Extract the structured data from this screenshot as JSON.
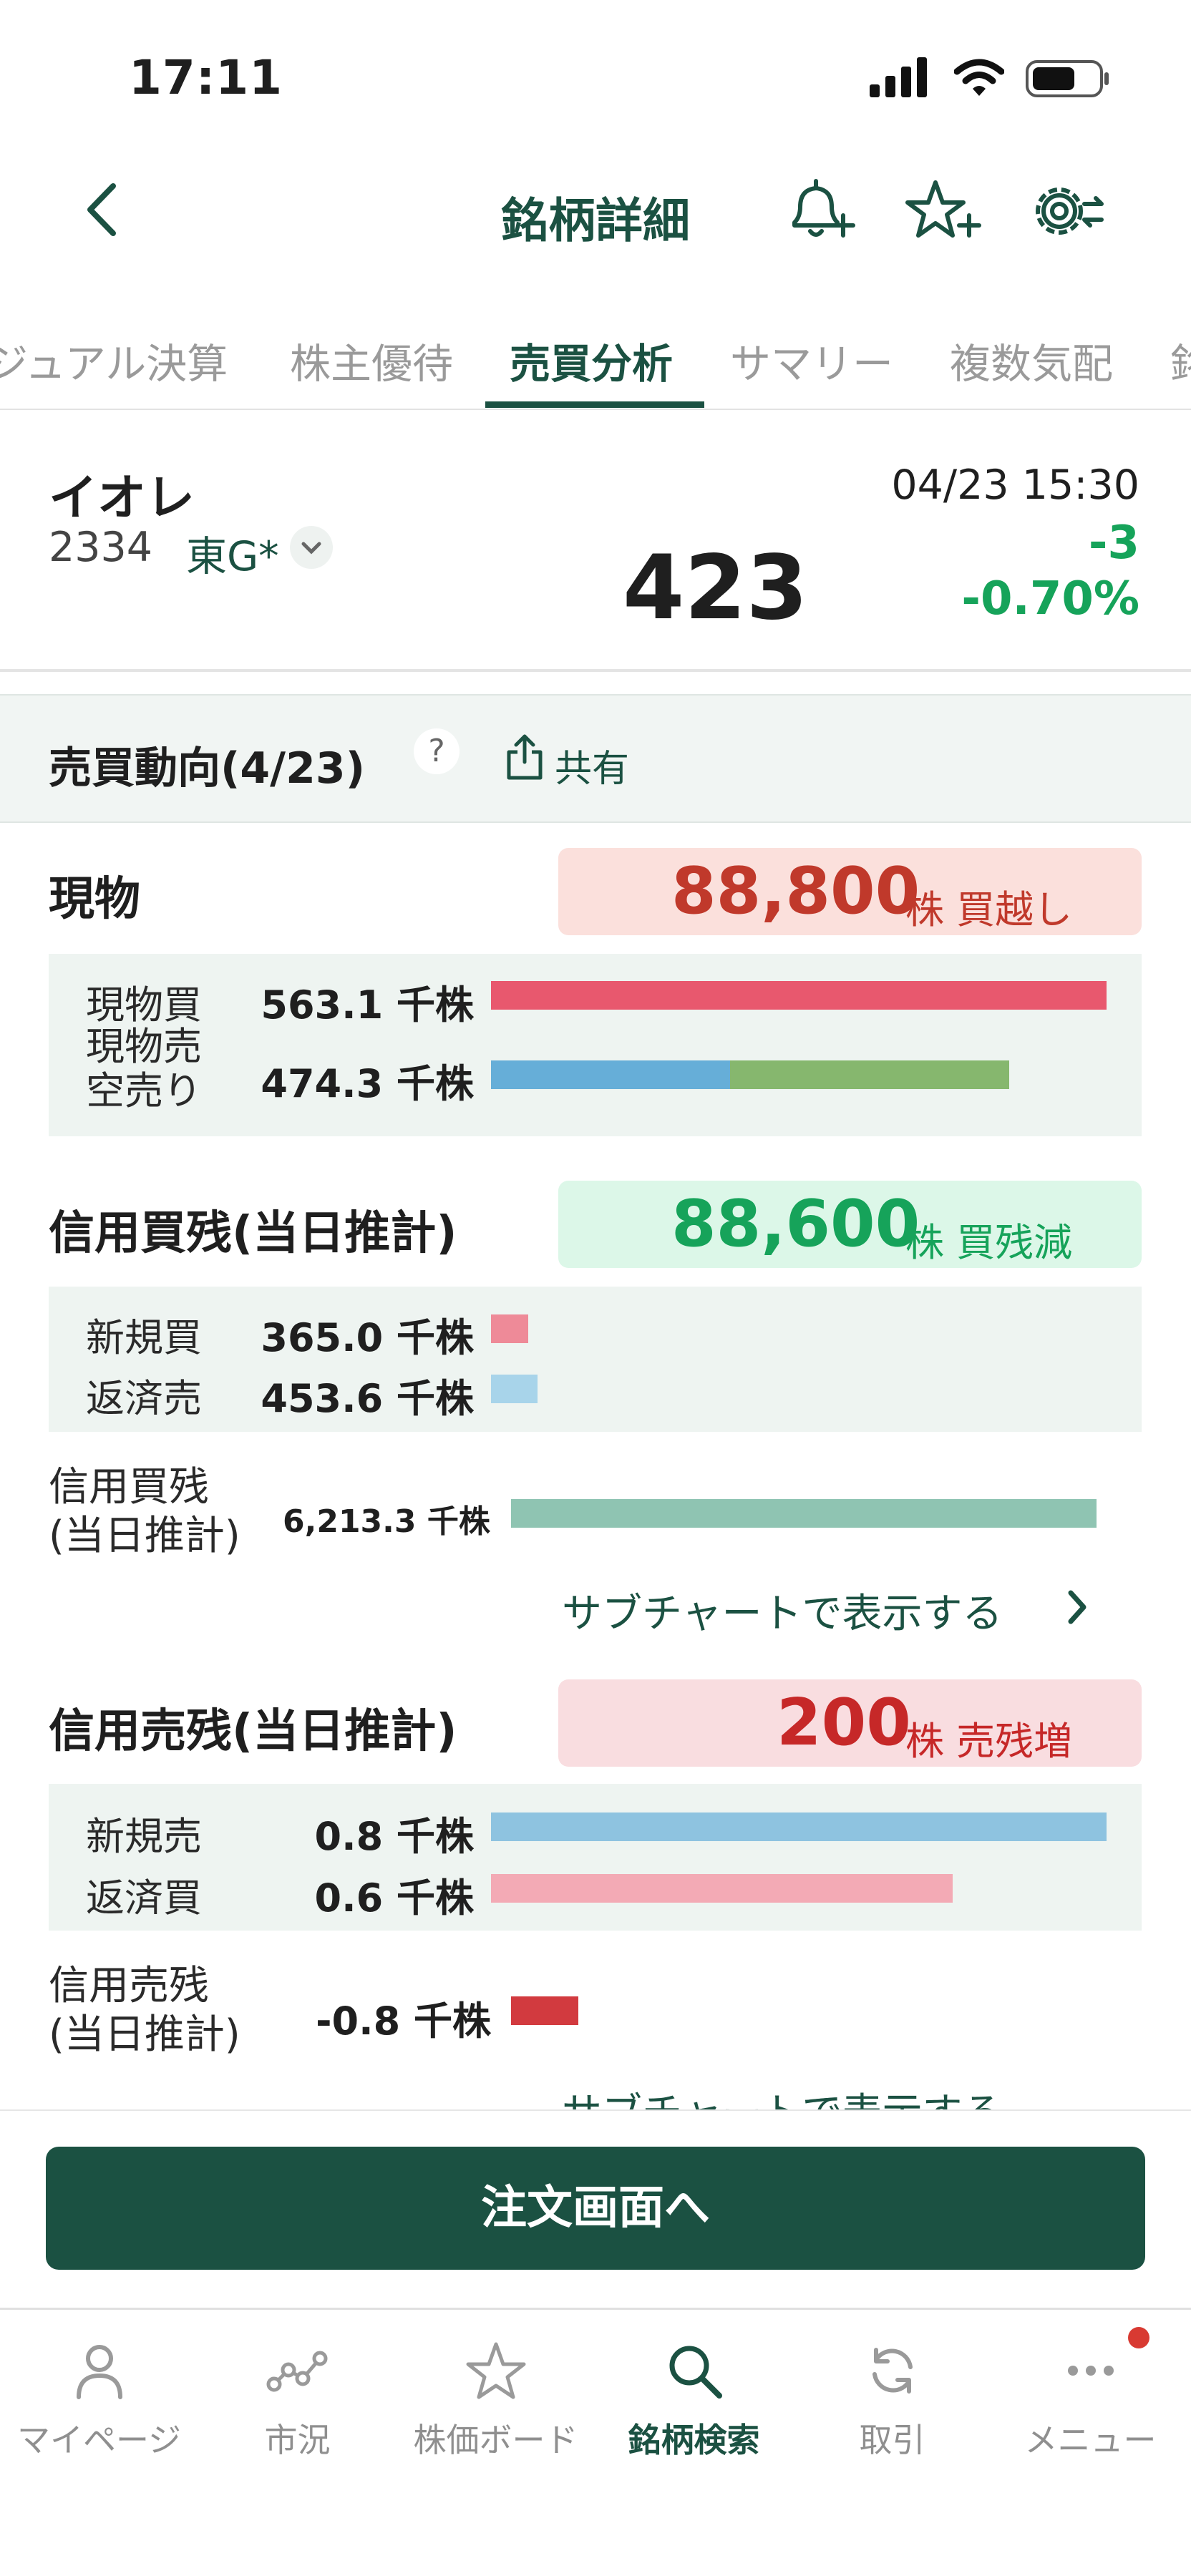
{
  "status_bar": {
    "time": "17:11"
  },
  "header": {
    "title": "銘柄詳細",
    "icons": [
      "back-icon",
      "bell-plus-icon",
      "star-plus-icon",
      "gear-icon"
    ]
  },
  "tabs": [
    {
      "label": "ジュアル決算",
      "active": false
    },
    {
      "label": "株主優待",
      "active": false
    },
    {
      "label": "売買分析",
      "active": true
    },
    {
      "label": "サマリー",
      "active": false
    },
    {
      "label": "複数気配",
      "active": false
    },
    {
      "label": "銘",
      "active": false
    }
  ],
  "stock": {
    "name": "イオレ",
    "code": "2334",
    "market": "東G*",
    "datetime": "04/23 15:30",
    "price": "423",
    "change": "-3",
    "change_pct": "-0.70%"
  },
  "section": {
    "title": "売買動向(4/23)",
    "help": "?",
    "share": "共有"
  },
  "genbutsu": {
    "title": "現物",
    "net_value": "88,800",
    "net_unit": "株 買越し",
    "rows": [
      {
        "label": "現物買",
        "value": "563.1 千株",
        "ratio": 1.0
      },
      {
        "label": "現物売\n空売り",
        "value": "474.3 千株",
        "ratio": 0.842,
        "short_ratio": 0.388
      }
    ]
  },
  "shinyo_kai": {
    "title": "信用買残(当日推計)",
    "net_value": "88,600",
    "net_unit": "株 買残減",
    "rows": [
      {
        "label": "新規買",
        "value": "365.0 千株",
        "ratio": 0.06
      },
      {
        "label": "返済売",
        "value": "453.6 千株",
        "ratio": 0.075
      }
    ],
    "balance_label": "信用買残\n(当日推計)",
    "balance_value": "6,213.3 千株",
    "balance_ratio": 0.985,
    "link": "サブチャートで表示する"
  },
  "shinyo_uri": {
    "title": "信用売残(当日推計)",
    "net_value": "200",
    "net_unit": "株 売残増",
    "rows": [
      {
        "label": "新規売",
        "value": "0.8 千株",
        "ratio": 1.0
      },
      {
        "label": "返済買",
        "value": "0.6 千株",
        "ratio": 0.75
      }
    ],
    "balance_label": "信用売残\n(当日推計)",
    "balance_value": "-0.8 千株",
    "balance_ratio": 0.08,
    "link": "サブチャートで表示する"
  },
  "order_button": "注文画面へ",
  "nav": [
    {
      "label": "マイページ",
      "icon": "person-icon",
      "active": false
    },
    {
      "label": "市況",
      "icon": "market-icon",
      "active": false
    },
    {
      "label": "株価ボード",
      "icon": "star-icon",
      "active": false
    },
    {
      "label": "銘柄検索",
      "icon": "search-icon",
      "active": true
    },
    {
      "label": "取引",
      "icon": "refresh-icon",
      "active": false
    },
    {
      "label": "メニュー",
      "icon": "more-icon",
      "active": false
    }
  ],
  "colors": {
    "brand": "#1b5142",
    "up_green": "#16a35a",
    "buy_red": "#e8586e",
    "sell_blue": "#66aed8",
    "short_green": "#86b76e"
  }
}
